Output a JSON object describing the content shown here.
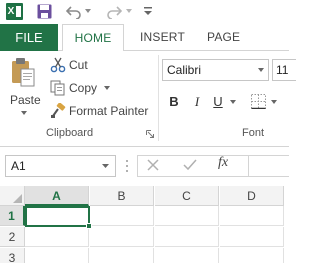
{
  "quick_access": {
    "app_icon": "excel-logo-icon",
    "app_letter": "X",
    "save_icon": "save-icon",
    "undo_icon": "undo-icon",
    "redo_icon": "redo-icon",
    "customize_icon": "customize-toolbar-icon"
  },
  "tabs": {
    "file": "FILE",
    "home": "HOME",
    "insert": "INSERT",
    "page_layout": "PAGE LAYOUT"
  },
  "ribbon": {
    "clipboard": {
      "paste": "Paste",
      "cut": "Cut",
      "copy": "Copy",
      "format_painter": "Format Painter",
      "group_label": "Clipboard"
    },
    "font": {
      "font_name": "Calibri",
      "font_size": "11",
      "bold": "B",
      "italic": "I",
      "underline": "U",
      "group_label": "Font"
    }
  },
  "formula_bar": {
    "name_box": "A1",
    "fx": "fx",
    "formula": ""
  },
  "grid": {
    "columns": [
      "A",
      "B",
      "C",
      "D"
    ],
    "rows": [
      "1",
      "2",
      "3"
    ],
    "active_cell": "A1"
  },
  "colors": {
    "accent": "#217346"
  }
}
